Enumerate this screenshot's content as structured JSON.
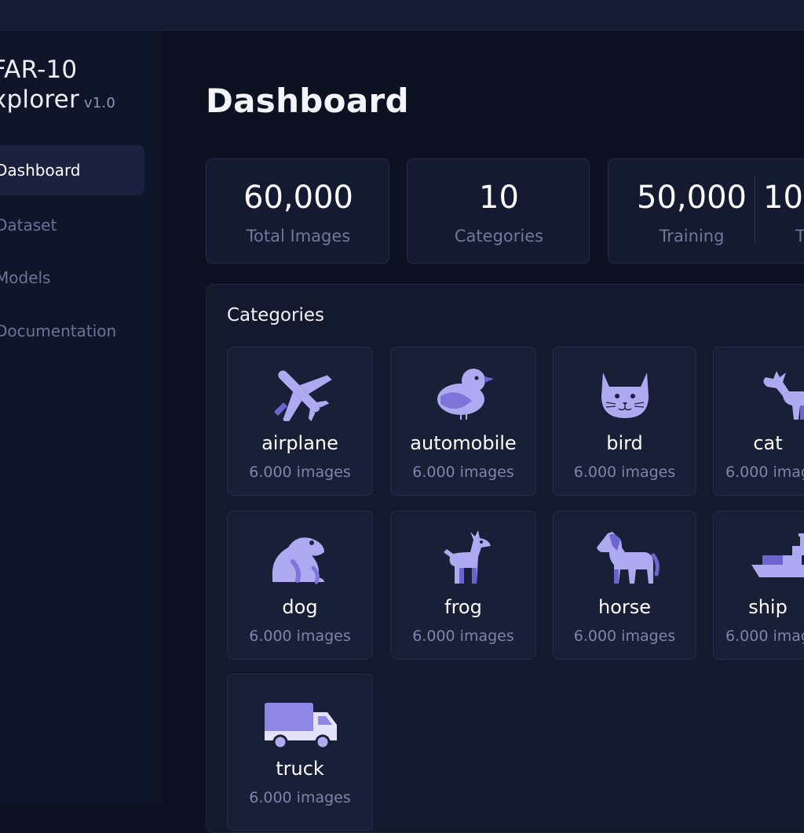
{
  "app": {
    "title_line1": "FAR-10",
    "title_line2": "xplorer",
    "version": "v1.0"
  },
  "sidebar": {
    "items": [
      {
        "label": "Dashboard",
        "active": true
      },
      {
        "label": "Dataset",
        "active": false
      },
      {
        "label": "Models",
        "active": false
      },
      {
        "label": "Documentation",
        "active": false
      }
    ]
  },
  "page": {
    "title": "Dashboard"
  },
  "stats": {
    "total": {
      "value": "60,000",
      "label": "Total Images"
    },
    "categories": {
      "value": "10",
      "label": "Categories"
    },
    "training": {
      "value": "50,000",
      "label": "Training"
    },
    "test": {
      "value": "10,",
      "label": "T"
    }
  },
  "categories_section": {
    "heading": "Categories",
    "cards": [
      {
        "name": "airplane",
        "count": "6.000 images",
        "icon": "airplane-icon"
      },
      {
        "name": "automobile",
        "count": "6.000 images",
        "icon": "bird-icon"
      },
      {
        "name": "bird",
        "count": "6.000 images",
        "icon": "cat-icon"
      },
      {
        "name": "cat",
        "count": "6.000 imag",
        "icon": "deer-icon"
      },
      {
        "name": "dog",
        "count": "6.000 images",
        "icon": "frog-icon"
      },
      {
        "name": "frog",
        "count": "6.000 images",
        "icon": "deer-icon"
      },
      {
        "name": "horse",
        "count": "6.000 images",
        "icon": "horse-icon"
      },
      {
        "name": "ship",
        "count": "6.000 imag",
        "icon": "ship-icon"
      },
      {
        "name": "truck",
        "count": "6.000 images",
        "icon": "truck-icon"
      }
    ]
  },
  "colors": {
    "background": "#0d1222",
    "panel": "#131a2e",
    "card": "#182038",
    "icon_light": "#aeaaf2",
    "icon_dark": "#6d64cf",
    "muted_text": "#7c85a9"
  }
}
